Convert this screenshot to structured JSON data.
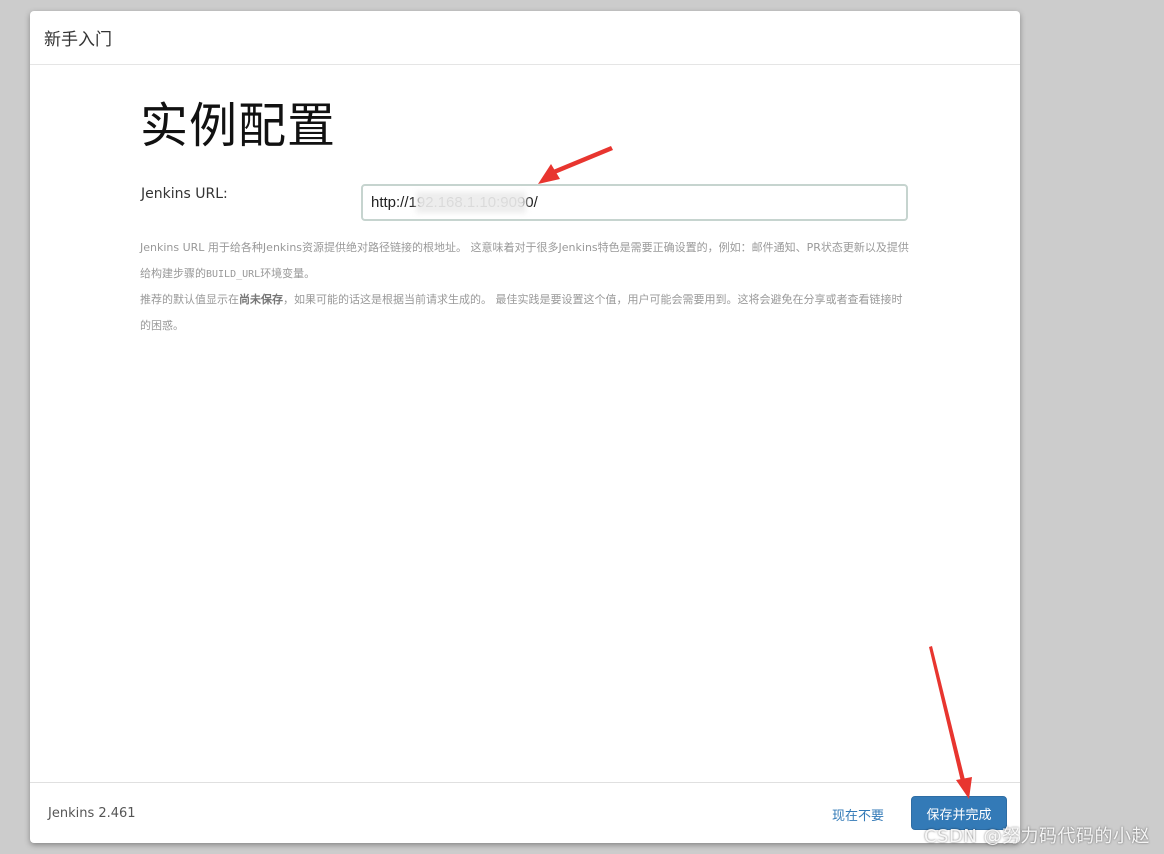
{
  "dialog": {
    "title": "新手入门"
  },
  "main": {
    "heading": "实例配置",
    "url_label": "Jenkins URL:",
    "url_value": "http://192.168.1.10:9090/",
    "help": {
      "p1_part1": "Jenkins URL 用于给各种Jenkins资源提供绝对路径链接的根地址。 这意味着对于很多Jenkins特色是需要正确设置的，例如：邮件通知、PR状态更新以及提供给构建步骤的",
      "p1_code": "BUILD_URL",
      "p1_part2": "环境变量。",
      "p2_part1": "推荐的默认值显示在",
      "p2_bold": "尚未保存",
      "p2_part2": "，如果可能的话这是根据当前请求生成的。 最佳实践是要设置这个值，用户可能会需要用到。这将会避免在分享或者查看链接时的困惑。"
    }
  },
  "footer": {
    "version": "Jenkins 2.461",
    "skip_label": "现在不要",
    "save_label": "保存并完成"
  },
  "watermark": "CSDN @努力码代码的小赵",
  "colors": {
    "background": "#cccccc",
    "primary": "#337ab7",
    "link": "#337ab7",
    "annotation_arrow": "#e8352f"
  }
}
